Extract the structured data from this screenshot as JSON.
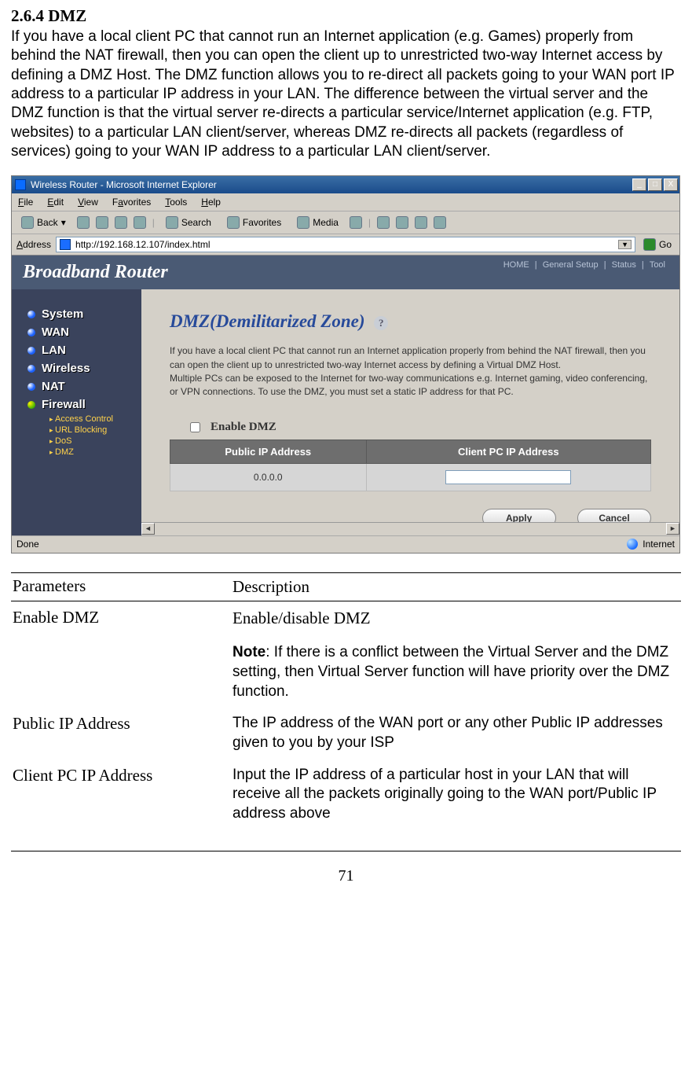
{
  "section": {
    "number": "2.6.4",
    "title": "DMZ"
  },
  "intro": "If you have a local client PC that cannot run an Internet application (e.g. Games) properly from behind the NAT firewall, then you can open the client up to unrestricted two-way Internet access by defining a DMZ Host. The DMZ function allows you to re-direct all packets going to your WAN port IP address to a particular IP address in your LAN. The difference between the virtual server and the DMZ function is that the virtual server re-directs a particular service/Internet application (e.g. FTP, websites) to a particular LAN client/server, whereas DMZ re-directs all packets (regardless of services) going to your WAN IP address to a particular LAN client/server.",
  "ie": {
    "title": "Wireless Router - Microsoft Internet Explorer",
    "menu": {
      "file": "File",
      "edit": "Edit",
      "view": "View",
      "favorites": "Favorites",
      "tools": "Tools",
      "help": "Help"
    },
    "toolbar": {
      "back": "Back",
      "search": "Search",
      "favorites": "Favorites",
      "media": "Media"
    },
    "address_label": "Address",
    "address_value": "http://192.168.12.107/index.html",
    "go": "Go",
    "status_left": "Done",
    "status_right": "Internet",
    "winbtns": {
      "min": "_",
      "max": "□",
      "close": "X"
    }
  },
  "router": {
    "brand": "Broadband Router",
    "toplinks": [
      "HOME",
      "General Setup",
      "Status",
      "Tool"
    ],
    "sidebar": {
      "items": [
        "System",
        "WAN",
        "LAN",
        "Wireless",
        "NAT",
        "Firewall"
      ],
      "firewall_sub": [
        "Access Control",
        "URL Blocking",
        "DoS",
        "DMZ"
      ]
    },
    "page": {
      "title": "DMZ(Demilitarized Zone)",
      "desc": "If you have a local client PC that cannot run an Internet application properly from behind the NAT firewall, then you can open the client up to unrestricted two-way Internet access by defining a Virtual DMZ Host.\nMultiple PCs can be exposed to the Internet for two-way communications e.g. Internet gaming, video conferencing, or VPN connections. To use the DMZ, you must set a static IP address for that PC.",
      "enable_label": "Enable DMZ",
      "table": {
        "hdr1": "Public IP Address",
        "hdr2": "Client PC IP Address",
        "public_val": "0.0.0.0",
        "client_val": ""
      },
      "buttons": {
        "apply": "Apply",
        "cancel": "Cancel"
      }
    }
  },
  "params": {
    "hdr_param": "Parameters",
    "hdr_desc": "Description",
    "rows": [
      {
        "param": "Enable DMZ",
        "desc": "Enable/disable DMZ",
        "note_label": "Note",
        "note": ": If there is a conflict between the Virtual Server and the DMZ setting, then Virtual Server function will have priority over the DMZ function."
      },
      {
        "param": "Public IP Address",
        "desc": "The IP address of the WAN port or any other Public IP addresses given to you by your ISP"
      },
      {
        "param": "Client PC IP Address",
        "desc": "Input the IP address of a particular host in your LAN that will receive all the packets originally going to the WAN port/Public IP address above"
      }
    ]
  },
  "page_number": "71"
}
